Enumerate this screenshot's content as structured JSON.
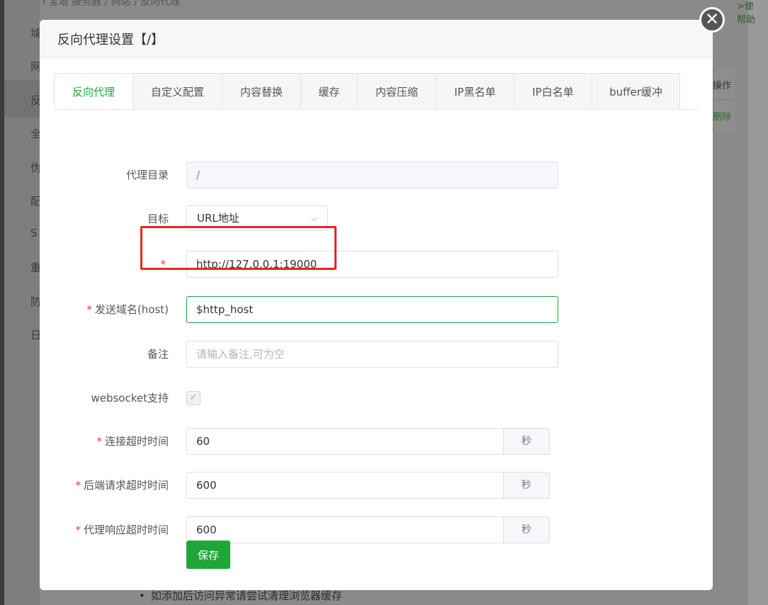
{
  "background": {
    "top_text": "I 宝塔 服务器 / 网站 / 反向代理",
    "sidebar_items": [
      "域",
      "网",
      "反",
      "全",
      "伪",
      "配",
      "S",
      "重",
      "防",
      "日"
    ],
    "right_links": [
      ">使",
      "帮助"
    ],
    "table_header": "操作",
    "table_action": "删除",
    "footer_note": "如添加后访问异常请尝试清理浏览器缓存"
  },
  "modal": {
    "title": "反向代理设置【/】",
    "close_icon": "close-icon",
    "tabs": [
      {
        "label": "反向代理",
        "active": true
      },
      {
        "label": "自定义配置",
        "active": false
      },
      {
        "label": "内容替换",
        "active": false
      },
      {
        "label": "缓存",
        "active": false
      },
      {
        "label": "内容压缩",
        "active": false
      },
      {
        "label": "IP黑名单",
        "active": false
      },
      {
        "label": "IP白名单",
        "active": false
      },
      {
        "label": "buffer缓冲",
        "active": false
      }
    ],
    "form": {
      "proxy_dir": {
        "label": "代理目录",
        "value": "/"
      },
      "target": {
        "label": "目标",
        "value": "URL地址"
      },
      "target_url": {
        "required_mark": "*",
        "label": "",
        "value": "http://127.0.0.1:19000"
      },
      "host": {
        "required_mark": "*",
        "label": "发送域名(host)",
        "value": "$http_host"
      },
      "remark": {
        "label": "备注",
        "value": "",
        "placeholder": "请输入备注,可为空"
      },
      "websocket": {
        "label": "websocket支持",
        "checked": true
      },
      "connect_timeout": {
        "required_mark": "*",
        "label": "连接超时时间",
        "value": "60",
        "unit": "秒"
      },
      "backend_timeout": {
        "required_mark": "*",
        "label": "后端请求超时时间",
        "value": "600",
        "unit": "秒"
      },
      "response_timeout": {
        "required_mark": "*",
        "label": "代理响应超时时间",
        "value": "600",
        "unit": "秒"
      },
      "save_label": "保存"
    }
  },
  "colors": {
    "accent": "#20a53a",
    "required": "#e4393c",
    "annotation": "#e8271f"
  }
}
